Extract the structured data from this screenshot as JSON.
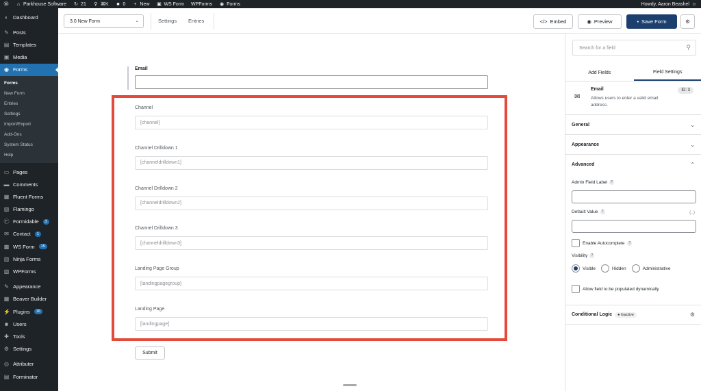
{
  "admin_bar": {
    "site_name": "Parkhouse Software",
    "updates_count": "21",
    "shortcut": "⌘K",
    "comments_count": "0",
    "new_label": "New",
    "items": [
      "WS Form",
      "WPForms",
      "Forms"
    ],
    "greeting": "Howdy, Aaron Beashel"
  },
  "sidebar": {
    "top_items": [
      {
        "label": "Dashboard",
        "icon": "dashboard-icon"
      }
    ],
    "group1": [
      {
        "label": "Posts",
        "icon": "pin-icon"
      },
      {
        "label": "Templates",
        "icon": "folder-icon"
      },
      {
        "label": "Media",
        "icon": "media-icon"
      }
    ],
    "current": {
      "label": "Forms",
      "icon": "forms-icon"
    },
    "submenu": [
      "Forms",
      "New Form",
      "Entries",
      "Settings",
      "Import/Export",
      "Add-Ons",
      "System Status",
      "Help"
    ],
    "group2": [
      {
        "label": "Pages",
        "icon": "page-icon",
        "badge": ""
      },
      {
        "label": "Comments",
        "icon": "comment-icon",
        "badge": ""
      },
      {
        "label": "Fluent Forms",
        "icon": "fluent-icon",
        "badge": ""
      },
      {
        "label": "Flamingo",
        "icon": "flamingo-icon",
        "badge": ""
      },
      {
        "label": "Formidable",
        "icon": "formidable-icon",
        "badge": "3"
      },
      {
        "label": "Contact",
        "icon": "mail-icon",
        "badge": "1"
      },
      {
        "label": "WS Form",
        "icon": "wsform-icon",
        "badge": "15"
      },
      {
        "label": "Ninja Forms",
        "icon": "ninja-icon",
        "badge": ""
      },
      {
        "label": "WPForms",
        "icon": "wpforms-icon",
        "badge": ""
      }
    ],
    "group3": [
      {
        "label": "Appearance",
        "icon": "brush-icon",
        "badge": ""
      },
      {
        "label": "Beaver Builder",
        "icon": "builder-icon",
        "badge": ""
      },
      {
        "label": "Plugins",
        "icon": "plugin-icon",
        "badge": "16"
      },
      {
        "label": "Users",
        "icon": "user-icon",
        "badge": ""
      },
      {
        "label": "Tools",
        "icon": "wrench-icon",
        "badge": ""
      },
      {
        "label": "Settings",
        "icon": "settings-icon",
        "badge": ""
      }
    ],
    "group4": [
      {
        "label": "Attributer",
        "icon": "attributer-icon",
        "badge": ""
      },
      {
        "label": "Forminator",
        "icon": "forminator-icon",
        "badge": ""
      }
    ]
  },
  "toolbar": {
    "form_name": "3.0 New Form",
    "settings_label": "Settings",
    "entries_label": "Entries",
    "embed_label": "Embed",
    "preview_label": "Preview",
    "save_label": "Save Form"
  },
  "canvas": {
    "email_label": "Email",
    "fields": [
      {
        "label": "Channel",
        "placeholder": "[channel]"
      },
      {
        "label": "Channel Drilldown 1",
        "placeholder": "[channeldrilldown1]"
      },
      {
        "label": "Channel Drilldown 2",
        "placeholder": "[channeldrilldown2]"
      },
      {
        "label": "Channel Drilldown 3",
        "placeholder": "[channeldrilldown3]"
      },
      {
        "label": "Landing Page Group",
        "placeholder": "[landingpagegroup]"
      },
      {
        "label": "Landing Page",
        "placeholder": "[landingpage]"
      }
    ],
    "submit_label": "Submit",
    "highlight_color": "#e44a3a"
  },
  "panel": {
    "search_placeholder": "Search for a field",
    "tabs": [
      "Add Fields",
      "Field Settings"
    ],
    "field": {
      "title": "Email",
      "desc": "Allows users to enter a valid email address.",
      "id": "ID: 3"
    },
    "sections": [
      "General",
      "Appearance",
      "Advanced"
    ],
    "admin_label": "Admin Field Label",
    "default_value": "Default Value",
    "vars_symbol": "{..}",
    "autocomplete": "Enable Autocomplete",
    "visibility": "Visibility",
    "vis_options": [
      "Visible",
      "Hidden",
      "Administrative"
    ],
    "dynamic": "Allow field to be populated dynamically",
    "conditional": "Conditional Logic",
    "inactive": "Inactive",
    "help_mark": "?"
  },
  "colors": {
    "accent": "#2271b1",
    "primary_button": "#1d3f6e",
    "admin_dark": "#1d2327"
  }
}
